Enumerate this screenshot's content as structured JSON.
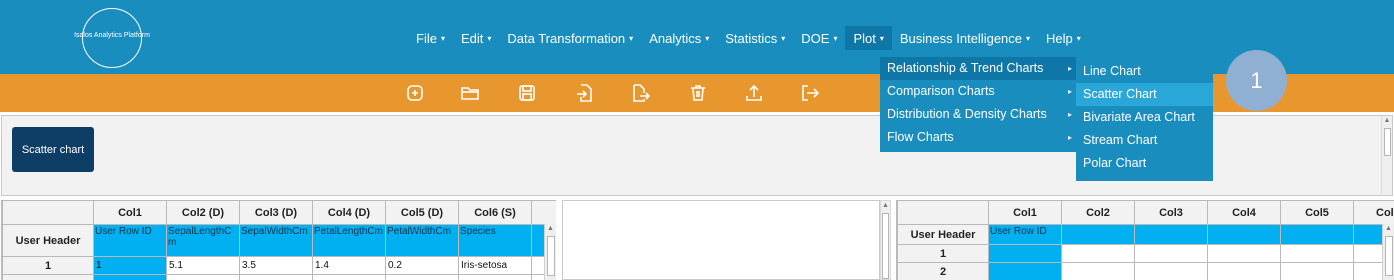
{
  "app": {
    "logo_text": "Isalos Analytics Platform"
  },
  "menu": [
    {
      "label": "File"
    },
    {
      "label": "Edit"
    },
    {
      "label": "Data Transformation"
    },
    {
      "label": "Analytics"
    },
    {
      "label": "Statistics"
    },
    {
      "label": "DOE"
    },
    {
      "label": "Plot"
    },
    {
      "label": "Business Intelligence"
    },
    {
      "label": "Help"
    }
  ],
  "menu_caret": "▾",
  "toolbar_icons": [
    "new-file-icon",
    "open-folder-icon",
    "save-icon",
    "import-icon",
    "export-icon",
    "delete-icon",
    "upload-icon",
    "exit-icon"
  ],
  "chart_panel": {
    "tile_label": "Scatter chart"
  },
  "plot_menu": {
    "items": [
      {
        "label": "Relationship & Trend Charts"
      },
      {
        "label": "Comparison Charts"
      },
      {
        "label": "Distribution & Density Charts"
      },
      {
        "label": "Flow Charts"
      }
    ],
    "sub_caret": "▸",
    "submenu": [
      {
        "label": "Line Chart"
      },
      {
        "label": "Scatter Chart"
      },
      {
        "label": "Bivariate Area Chart"
      },
      {
        "label": "Stream Chart"
      },
      {
        "label": "Polar Chart"
      }
    ]
  },
  "step_badge": "1",
  "left_grid": {
    "columns": [
      "Col1",
      "Col2 (D)",
      "Col3 (D)",
      "Col4 (D)",
      "Col5 (D)",
      "Col6 (S)"
    ],
    "user_header_label": "User Header",
    "user_header": [
      "User Row ID",
      "SepalLengthCm",
      "SepalWidthCm",
      "PetalLengthCm",
      "PetalWidthCm",
      "Species"
    ],
    "rows": [
      {
        "header": "1",
        "cells": [
          "1",
          "5.1",
          "3.5",
          "1.4",
          "0.2",
          "Iris-setosa"
        ]
      }
    ]
  },
  "right_grid": {
    "columns": [
      "Col1",
      "Col2",
      "Col3",
      "Col4",
      "Col5",
      "Col"
    ],
    "user_header_label": "User Header",
    "user_header_first": "User Row ID",
    "row_headers": [
      "1",
      "2"
    ]
  },
  "colors": {
    "header_blue": "#1a8dbf",
    "toolbar_orange": "#e8972f",
    "grid_blue": "#00b0f0",
    "tile_navy": "#0e3d66"
  }
}
